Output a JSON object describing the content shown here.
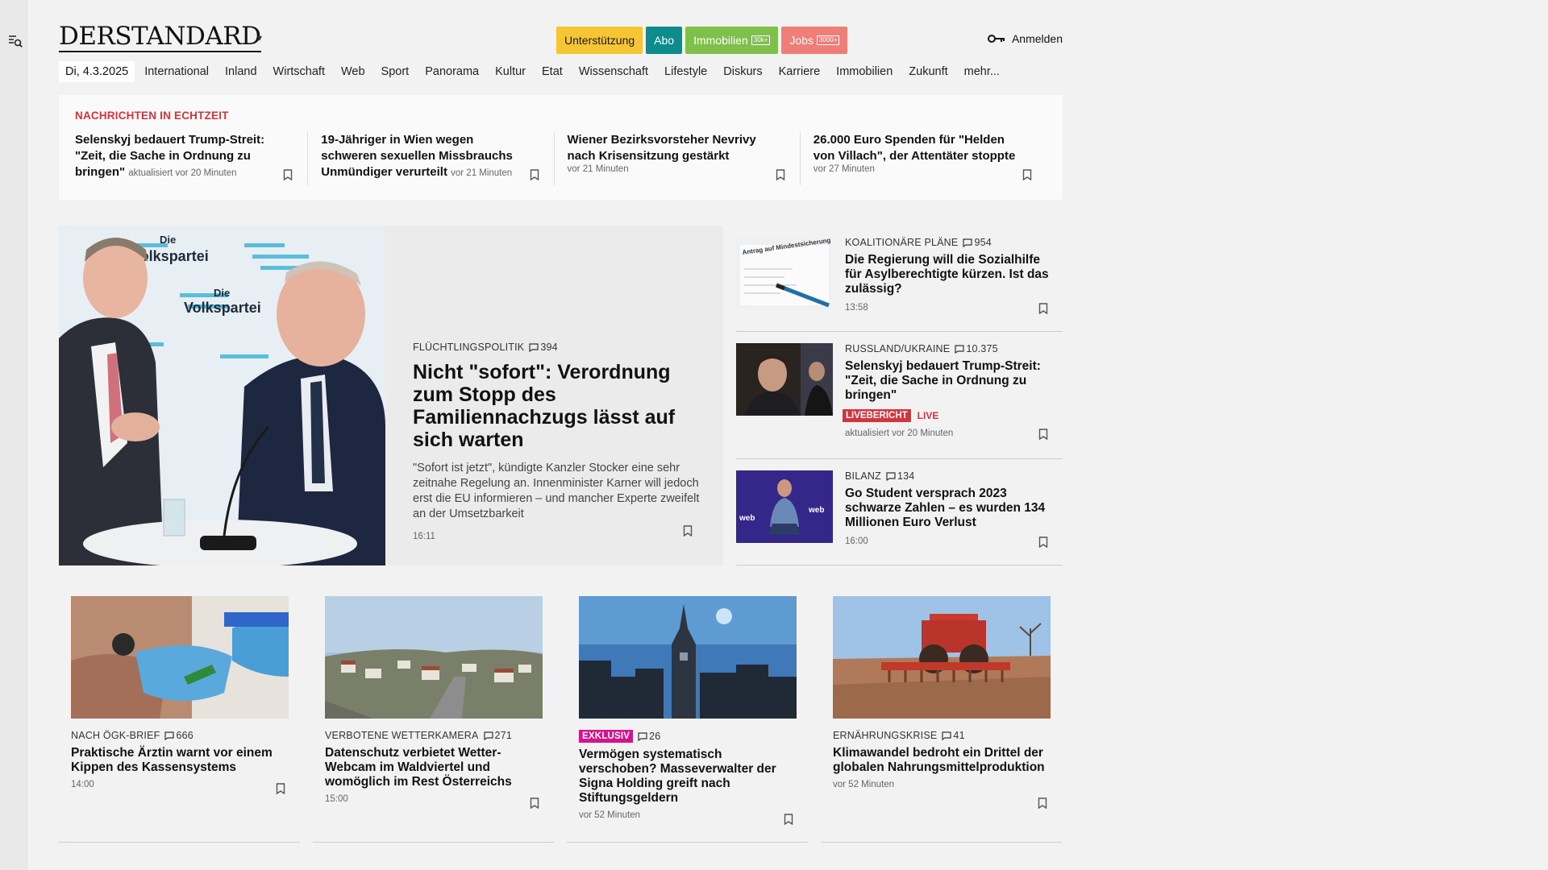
{
  "brand": {
    "logo": "DERSTANDARD"
  },
  "promo": {
    "support": "Unterstützung",
    "abo": "Abo",
    "immobilien": "Immobilien",
    "immobilien_tag": "30k+",
    "jobs": "Jobs",
    "jobs_tag": "3000+"
  },
  "login": "Anmelden",
  "nav": {
    "date": "Di, 4.3.2025",
    "items": [
      "International",
      "Inland",
      "Wirtschaft",
      "Web",
      "Sport",
      "Panorama",
      "Kultur",
      "Etat",
      "Wissenschaft",
      "Lifestyle",
      "Diskurs",
      "Karriere",
      "Immobilien",
      "Zukunft",
      "mehr..."
    ]
  },
  "ticker": {
    "title": "NACHRICHTEN IN ECHTZEIT",
    "items": [
      {
        "headline": "Selenskyj bedauert Trump-Streit: \"Zeit, die Sache in Ordnung zu bringen\"",
        "time": "aktualisiert vor 20 Minuten"
      },
      {
        "headline": "19-Jähriger in Wien wegen schweren sexuellen Missbrauchs Unmündiger verurteilt",
        "time": "vor 21 Minuten"
      },
      {
        "headline": "Wiener Bezirksvorsteher Nevrivy nach Krisensitzung gestärkt",
        "time": "vor 21 Minuten"
      },
      {
        "headline": "26.000 Euro Spenden für \"Helden von Villach\", der Attentäter stoppte",
        "time": "vor 27 Minuten"
      }
    ]
  },
  "lead": {
    "kicker": "FLÜCHTLINGSPOLITIK",
    "comments": "394",
    "headline": "Nicht \"sofort\": Verordnung zum Stopp des Familiennachzugs lässt auf sich warten",
    "teaser": "\"Sofort ist jetzt\", kündigte Kanzler Stocker eine sehr zeitnahe Regelung an. Innenminister Karner will jedoch erst die EU informieren – und mancher Experte zweifelt an der Umsetzbarkeit",
    "time": "16:11",
    "image_text": {
      "brand_small": "Die",
      "brand": "Volkspartei"
    }
  },
  "side": [
    {
      "kicker": "KOALITIONÄRE PLÄNE",
      "comments": "954",
      "headline": "Die Regierung will die Sozialhilfe für Asylberechtigte kürzen. Ist das zulässig?",
      "time": "13:58",
      "image_text": "Antrag auf Mindestsicherung"
    },
    {
      "kicker": "RUSSLAND/UKRAINE",
      "comments": "10.375",
      "headline": "Selenskyj bedauert Trump-Streit: \"Zeit, die Sache in Ordnung zu bringen\"",
      "badge": "LIVEBERICHT",
      "live": "LIVE",
      "time": "aktualisiert vor 20 Minuten"
    },
    {
      "kicker": "BILANZ",
      "comments": "134",
      "headline": "Go Student versprach 2023 schwarze Zahlen – es wurden 134 Millionen Euro Verlust",
      "time": "16:00",
      "image_text": "web"
    }
  ],
  "cards": [
    {
      "kicker": "NACH ÖGK-BRIEF",
      "comments": "666",
      "headline": "Praktische Ärztin warnt vor einem Kippen des Kassensystems",
      "time": "14:00"
    },
    {
      "kicker": "VERBOTENE WETTERKAMERA",
      "comments": "271",
      "headline": "Datenschutz verbietet Wetter-Webcam im Waldviertel und womöglich im Rest Österreichs",
      "time": "15:00"
    },
    {
      "badge": "EXKLUSIV",
      "comments": "26",
      "headline": "Vermögen systematisch verschoben? Masseverwalter der Signa Holding greift nach Stiftungsgeldern",
      "time": "vor 52 Minuten"
    },
    {
      "kicker": "ERNÄHRUNGSKRISE",
      "comments": "41",
      "headline": "Klimawandel bedroht ein Drittel der globalen Nahrungsmittelproduktion",
      "time": "vor 52 Minuten"
    }
  ],
  "colors": {
    "accent_red": "#d4343d",
    "support": "#f6c533",
    "abo": "#0c8c8c",
    "immobilien": "#7fc04b",
    "jobs": "#ef7e79",
    "exklusiv": "#d4148c"
  }
}
